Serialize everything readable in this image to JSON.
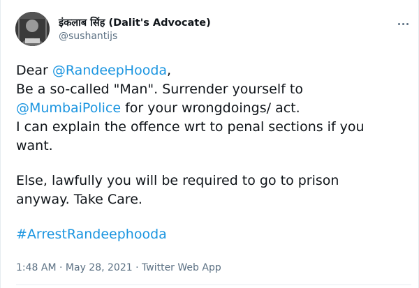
{
  "author": {
    "display_name": "इंकलाब सिंह (Dalit's Advocate)",
    "handle": "@sushantijs"
  },
  "more_menu": {
    "icon": "more-horizontal-icon"
  },
  "tweet": {
    "line1_prefix": "Dear ",
    "mention_randeep": "@RandeepHooda",
    "line1_suffix": ",",
    "line2": "Be a so-called \"Man\". Surrender yourself to",
    "mention_police": "@MumbaiPolice",
    "line3_suffix": " for your wrongdoings/ act.",
    "line4": "I can explain the offence wrt to penal sections if you",
    "line5": "want.",
    "line6": "Else, lawfully you will be required to go to prison",
    "line7": "anyway. Take Care.",
    "hashtag": "#ArrestRandeephooda"
  },
  "meta": {
    "time": "1:48 AM",
    "separator1": " · ",
    "date": "May 28, 2021",
    "separator2": " · ",
    "source": "Twitter Web App"
  },
  "colors": {
    "link": "#1b95e0",
    "text": "#0f1419",
    "secondary": "#5b7083"
  }
}
